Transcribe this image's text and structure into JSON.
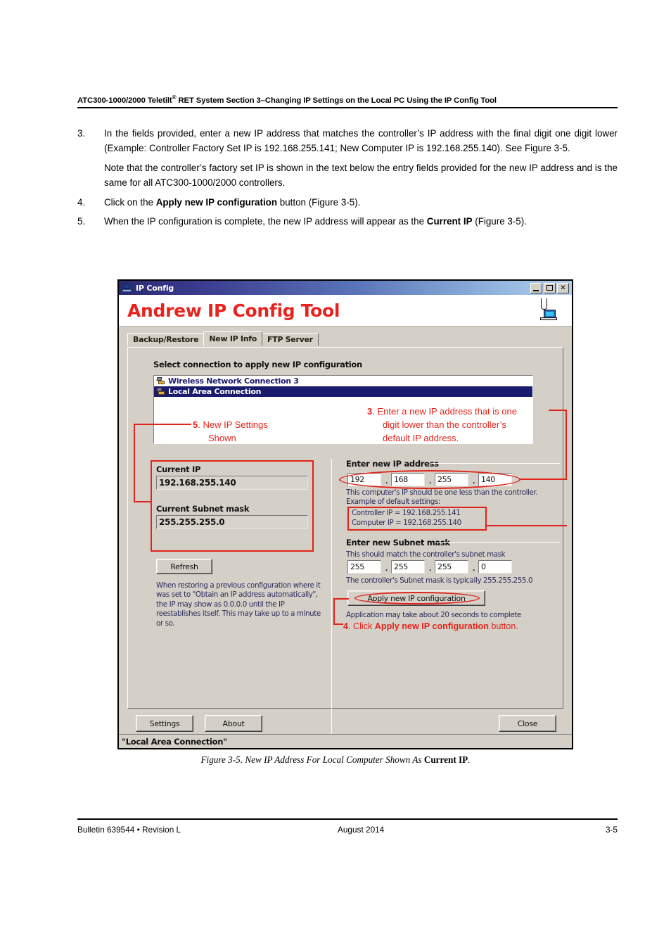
{
  "header": {
    "title_part1": "ATC300-1000/2000 Teletilt",
    "title_sup": "®",
    "title_part2": " RET System   Section 3–Changing IP Settings on the Local PC Using the IP Config Tool"
  },
  "steps": [
    {
      "num": "3.",
      "text": "In the fields provided, enter a new IP address that matches the controller’s IP address with the final digit one digit lower (Example: Controller Factory Set IP is 192.168.255.141; New Computer IP is 192.168.255.140). See Figure 3-5."
    },
    {
      "num": "4.",
      "pre": "Click on the ",
      "bold": "Apply new IP configuration",
      "post": " button (Figure 3-5)."
    },
    {
      "num": "5.",
      "pre": "When the IP configuration is complete, the new IP address will appear as the ",
      "bold": "Current IP",
      "post": " (Figure 3-5)."
    }
  ],
  "note": "Note that the controller’s factory set IP is shown in the text below the entry fields provided for the new IP address and is the same for all ATC300-1000/2000 controllers.",
  "app_window": {
    "titlebar": {
      "title": "IP Config",
      "minimize_label": "",
      "maximize_label": "",
      "close_label": "✕"
    },
    "brand_title": "Andrew IP Config Tool",
    "tabs": [
      {
        "label": "Backup/Restore",
        "active": false
      },
      {
        "label": "New IP Info",
        "active": true
      },
      {
        "label": "FTP Server",
        "active": false
      }
    ],
    "connection_section_label": "Select connection to apply new IP configuration",
    "connections": [
      {
        "label": "Wireless Network Connection 3",
        "selected": false
      },
      {
        "label": "Local Area Connection",
        "selected": true
      }
    ],
    "current_ip_label": "Current IP",
    "current_ip_value": "192.168.255.140",
    "current_subnet_label": "Current Subnet mask",
    "current_subnet_value": "255.255.255.0",
    "refresh_label": "Refresh",
    "restore_help": "When restoring a previous configuration where it was set to \"Obtain an IP address automatically\", the IP may show as 0.0.0.0 until the IP reestablishes itself.  This may take up to a minute or so.",
    "new_ip_group_label": "Enter new IP address",
    "new_ip_octets": [
      "192",
      "168",
      "255",
      "140"
    ],
    "new_ip_help_line1": "This computer's IP should be one less than the controller.",
    "new_ip_help_line2": "Example of default settings:",
    "example_controller": "Controller IP = 192.168.255.141",
    "example_computer": "Computer IP = 192.168.255.140",
    "new_subnet_group_label": "Enter new Subnet mask",
    "new_subnet_help": "This should match the controller's subnet mask",
    "new_subnet_octets": [
      "255",
      "255",
      "255",
      "0"
    ],
    "new_subnet_note": "The controller's Subnet mask is typically 255.255.255.0",
    "apply_button_label": "Apply new IP configuration",
    "apply_note": "Application may take about 20 seconds to complete",
    "settings_label": "Settings",
    "about_label": "About",
    "close_label": "Close",
    "statusbar_text": "\"Local Area Connection\""
  },
  "annotations": {
    "callout5": {
      "num": "5",
      "text": ". New IP Settings",
      "text2": "Shown"
    },
    "callout3": {
      "num": "3",
      "line1": ". Enter a new IP address that is one",
      "line2": "digit lower than the controller’s",
      "line3": "default IP address."
    },
    "callout4": {
      "num": "4",
      "pre": ".  Click ",
      "bold": "Apply new IP configuration",
      "post": " button."
    },
    "accent_color": "#e2231a"
  },
  "figure_caption": {
    "pre": "Figure 3-5.  New IP Address For Local Computer Shown As ",
    "bold": "Current IP",
    "post": "."
  },
  "footer": {
    "left": "Bulletin 639544  •   Revision L",
    "center": "August 2014",
    "right": "3-5"
  }
}
